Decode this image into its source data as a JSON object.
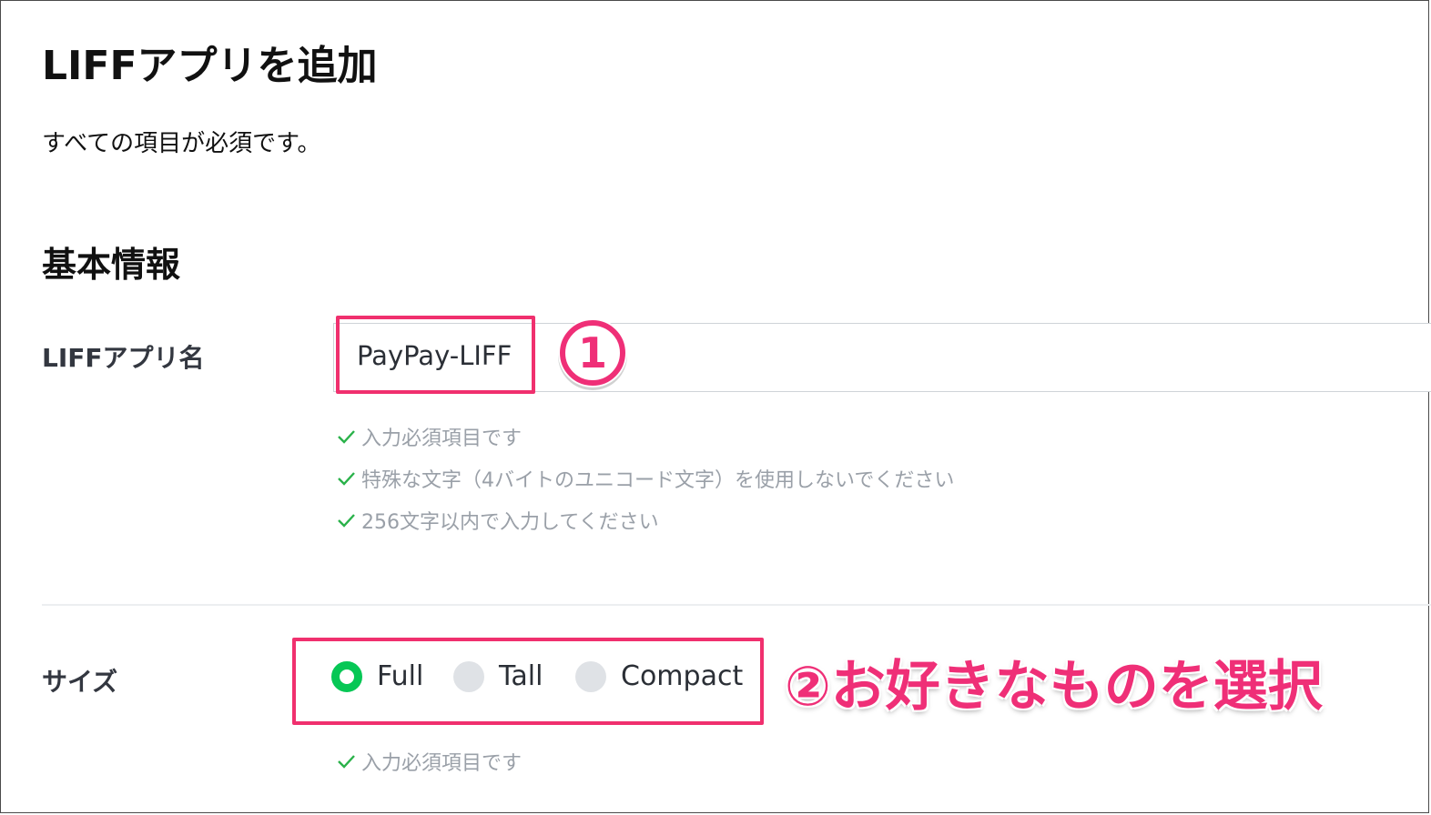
{
  "page": {
    "title": "LIFFアプリを追加",
    "description": "すべての項目が必須です。"
  },
  "section": {
    "title": "基本情報"
  },
  "liff_name": {
    "label": "LIFFアプリ名",
    "value": "PayPay-LIFF",
    "hints": [
      "入力必須項目です",
      "特殊な文字（4バイトのユニコード文字）を使用しないでください",
      "256文字以内で入力してください"
    ]
  },
  "size": {
    "label": "サイズ",
    "options": [
      "Full",
      "Tall",
      "Compact"
    ],
    "selected": "Full",
    "hint": "入力必須項目です"
  },
  "annotations": {
    "step_one": "①",
    "step_two": "②お好きなものを選択",
    "highlight_color": "#f0306e"
  },
  "colors": {
    "check": "#2ab24a",
    "radio_selected": "#06c755",
    "hint_text": "#9aa0a8"
  }
}
